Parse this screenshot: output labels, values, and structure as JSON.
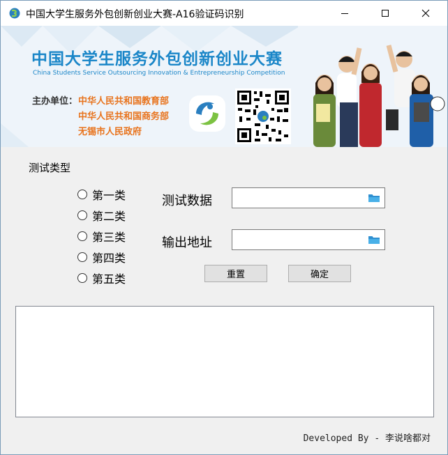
{
  "window": {
    "title": "中国大学生服务外包创新创业大赛-A16验证码识别",
    "controls": {
      "minimize": "minimize-icon",
      "maximize": "maximize-icon",
      "close": "close-icon"
    }
  },
  "banner": {
    "title": "中国大学生服务外包创新创业大赛",
    "subtitle": "China Students Service Outsourcing Innovation & Entrepreneurship Competition",
    "organizer_label": "主办单位：",
    "organizers": [
      "中华人民共和国教育部",
      "中华人民共和国商务部",
      "无锡市人民政府"
    ],
    "colors": {
      "title": "#1a86c8",
      "organizers": "#e8741e"
    }
  },
  "test_type": {
    "label": "测试类型",
    "options": [
      "第一类",
      "第二类",
      "第三类",
      "第四类",
      "第五类"
    ],
    "selected": null
  },
  "fields": {
    "test_data": {
      "label": "测试数据",
      "value": "",
      "icon": "folder-icon"
    },
    "output_path": {
      "label": "输出地址",
      "value": "",
      "icon": "folder-icon"
    }
  },
  "buttons": {
    "reset": "重置",
    "confirm": "确定"
  },
  "output": {
    "text": ""
  },
  "footer": {
    "credit": "Developed By - 李说啥都对"
  }
}
